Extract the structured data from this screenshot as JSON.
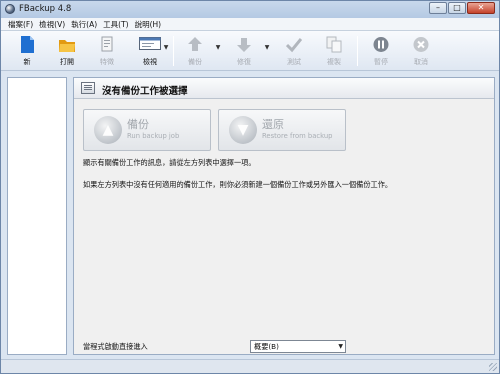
{
  "window": {
    "title": "FBackup  4.8",
    "controls": [
      "minimize",
      "maximize",
      "close"
    ]
  },
  "menu": {
    "items": [
      "檔案(F)",
      "檢視(V)",
      "執行(A)",
      "工具(T)",
      "說明(H)"
    ]
  },
  "toolbar": {
    "buttons": [
      {
        "label": "新",
        "icon": "new-doc-icon",
        "enabled": true
      },
      {
        "label": "打開",
        "icon": "folder-icon",
        "enabled": true
      },
      {
        "label": "特徵",
        "icon": "properties-icon",
        "enabled": false
      },
      {
        "label": "檢視",
        "icon": "view-icon",
        "enabled": true
      },
      {
        "label": "備份",
        "icon": "backup-arrow-icon",
        "enabled": false
      },
      {
        "label": "修復",
        "icon": "restore-arrow-icon",
        "enabled": false
      },
      {
        "label": "測試",
        "icon": "test-check-icon",
        "enabled": false
      },
      {
        "label": "複製",
        "icon": "copy-icon",
        "enabled": false
      },
      {
        "label": "暫停",
        "icon": "pause-icon",
        "enabled": false
      },
      {
        "label": "取消",
        "icon": "cancel-icon",
        "enabled": false
      }
    ]
  },
  "panel": {
    "header_title": "沒有備份工作被選擇",
    "backup_button": {
      "title": "備份",
      "subtitle": "Run backup job"
    },
    "restore_button": {
      "title": "還原",
      "subtitle": "Restore from backup"
    },
    "info_line1": "顯示有關備份工作的訊息，請從左方列表中選擇一項。",
    "info_line2": "如果左方列表中沒有任何適用的備份工作，則你必須新建一個備份工作或另外匯入一個備份工作。",
    "startup_label": "當程式啟動直接進入",
    "startup_value": "概要(B)"
  },
  "colors": {
    "window_bg": "#dbe5f1",
    "toolbar_bg": "#f8fafd",
    "panel_bg": "#f0f0f0",
    "disabled_text": "#a7abb2",
    "folder_yellow": "#f0b429",
    "new_doc_blue": "#1f6fd1",
    "pause_gray": "#7d8590"
  }
}
